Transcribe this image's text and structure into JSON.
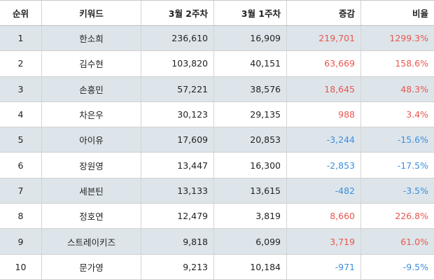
{
  "colors": {
    "positive": "#e8574f",
    "negative": "#3d8fdc",
    "shade": "#dde5ea"
  },
  "headers": {
    "rank": "순위",
    "keyword": "키워드",
    "week2": "3월 2주차",
    "week1": "3월 1주차",
    "change": "증감",
    "ratio": "비율"
  },
  "rows": [
    {
      "rank": "1",
      "keyword": "한소희",
      "week2": "236,610",
      "week1": "16,909",
      "change": "219,701",
      "ratio": "1299.3%",
      "trend": "pos"
    },
    {
      "rank": "2",
      "keyword": "김수현",
      "week2": "103,820",
      "week1": "40,151",
      "change": "63,669",
      "ratio": "158.6%",
      "trend": "pos"
    },
    {
      "rank": "3",
      "keyword": "손흥민",
      "week2": "57,221",
      "week1": "38,576",
      "change": "18,645",
      "ratio": "48.3%",
      "trend": "pos"
    },
    {
      "rank": "4",
      "keyword": "차은우",
      "week2": "30,123",
      "week1": "29,135",
      "change": "988",
      "ratio": "3.4%",
      "trend": "pos"
    },
    {
      "rank": "5",
      "keyword": "아이유",
      "week2": "17,609",
      "week1": "20,853",
      "change": "-3,244",
      "ratio": "-15.6%",
      "trend": "neg"
    },
    {
      "rank": "6",
      "keyword": "장원영",
      "week2": "13,447",
      "week1": "16,300",
      "change": "-2,853",
      "ratio": "-17.5%",
      "trend": "neg"
    },
    {
      "rank": "7",
      "keyword": "세븐틴",
      "week2": "13,133",
      "week1": "13,615",
      "change": "-482",
      "ratio": "-3.5%",
      "trend": "neg"
    },
    {
      "rank": "8",
      "keyword": "정호연",
      "week2": "12,479",
      "week1": "3,819",
      "change": "8,660",
      "ratio": "226.8%",
      "trend": "pos"
    },
    {
      "rank": "9",
      "keyword": "스트레이키즈",
      "week2": "9,818",
      "week1": "6,099",
      "change": "3,719",
      "ratio": "61.0%",
      "trend": "pos"
    },
    {
      "rank": "10",
      "keyword": "문가영",
      "week2": "9,213",
      "week1": "10,184",
      "change": "-971",
      "ratio": "-9.5%",
      "trend": "neg"
    }
  ]
}
